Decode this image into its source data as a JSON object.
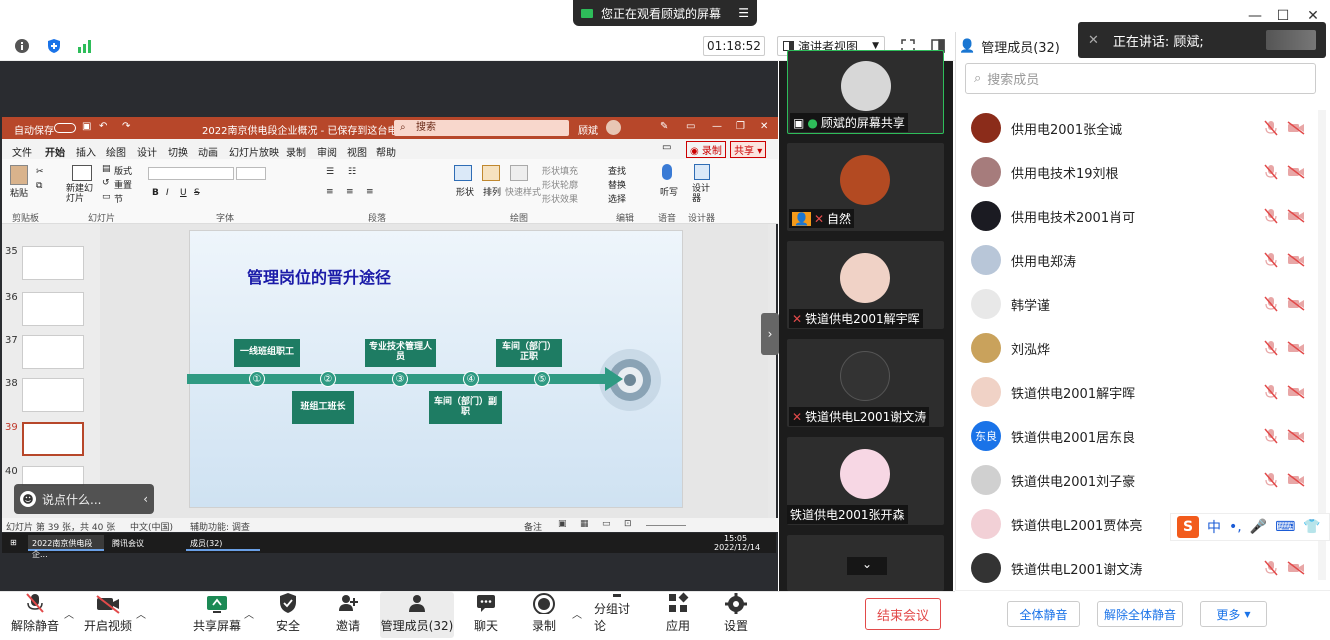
{
  "window": {
    "viewing_banner": "您正在观看顾斌的屏幕"
  },
  "toolbar": {
    "timer": "01:18:52",
    "view_mode": "演讲者视图"
  },
  "panel": {
    "title": "管理成员(32)",
    "speaking_label": "正在讲话: 顾斌;",
    "search_placeholder": "搜索成员",
    "members": [
      {
        "name": "供用电2001张全诚",
        "avatar_color": "#8b2c1a"
      },
      {
        "name": "供用电技术19刘根",
        "avatar_color": "#a67c7c"
      },
      {
        "name": "供用电技术2001肖可",
        "avatar_color": "#1b1b22"
      },
      {
        "name": "供用电郑涛",
        "avatar_color": "#b8c6d8"
      },
      {
        "name": "韩学谨",
        "avatar_color": "#e8e8e8"
      },
      {
        "name": "刘泓烨",
        "avatar_color": "#c9a25c"
      },
      {
        "name": "铁道供电2001解宇晖",
        "avatar_color": "#f0d2c6"
      },
      {
        "name": "铁道供电2001居东良",
        "avatar_color": "#1a73e8",
        "initials": "东良"
      },
      {
        "name": "铁道供电2001刘子豪",
        "avatar_color": "#d0d0d0"
      },
      {
        "name": "铁道供电L2001贾体亮",
        "avatar_color": "#f2d0d6"
      },
      {
        "name": "铁道供电L2001谢文涛",
        "avatar_color": "#333333"
      }
    ],
    "buttons": {
      "mute_all": "全体静音",
      "unmute_all": "解除全体静音",
      "more": "更多"
    }
  },
  "videos": [
    {
      "name": "顾斌的屏幕共享",
      "avatar_color": "#d7d7d7"
    },
    {
      "name": "自然",
      "avatar_color": "#b34a22"
    },
    {
      "name": "铁道供电2001解宇晖",
      "avatar_color": "#f0d2c6"
    },
    {
      "name": "铁道供电L2001谢文涛",
      "avatar_color": "#333333"
    },
    {
      "name": "铁道供电2001张开森",
      "avatar_color": "#f7d7e4"
    }
  ],
  "ppt": {
    "autosave": "自动保存",
    "file_title": "2022南京供电段企业概况 - 已保存到这台电脑",
    "search": "搜索",
    "user": "顾斌",
    "tabs": [
      "文件",
      "开始",
      "插入",
      "绘图",
      "设计",
      "切换",
      "动画",
      "幻灯片放映",
      "录制",
      "审阅",
      "视图",
      "帮助"
    ],
    "record": "录制",
    "share": "共享",
    "groups": [
      "剪贴板",
      "幻灯片",
      "字体",
      "段落",
      "绘图",
      "编辑",
      "语音",
      "设计器"
    ],
    "ribbon_labels": {
      "paste": "粘贴",
      "new_slide": "新建幻灯片",
      "layout": "版式",
      "reset": "重置",
      "section": "节",
      "shape": "形状",
      "arrange": "排列",
      "quick_style": "快速样式",
      "fill": "形状填充",
      "outline": "形状轮廓",
      "effect": "形状效果",
      "find": "查找",
      "replace": "替换",
      "select": "选择",
      "dictate": "听写",
      "designer": "设计器"
    },
    "thumb_numbers": [
      "35",
      "36",
      "37",
      "38",
      "39",
      "40"
    ],
    "slide": {
      "title": "管理岗位的晋升途径",
      "steps": [
        "一线班组职工",
        "班组工班长",
        "专业技术管理人员",
        "车间（部门）副职",
        "车间（部门）正职"
      ],
      "numbers": [
        "①",
        "②",
        "③",
        "④",
        "⑤"
      ]
    },
    "status": {
      "slide_count": "幻灯片 第 39 张，共 40 张",
      "language": "中文(中国)",
      "accessibility": "辅助功能: 调查",
      "notes": "备注"
    },
    "taskbar": {
      "item1": "2022南京供电段企...",
      "item2": "腾讯会议",
      "item3": "成员(32)",
      "time": "15:05",
      "date": "2022/12/14"
    }
  },
  "say_bar": "说点什么...",
  "bottom": {
    "unmute": "解除静音",
    "start_video": "开启视频",
    "share_screen": "共享屏幕",
    "security": "安全",
    "invite": "邀请",
    "members": "管理成员(32)",
    "chat": "聊天",
    "record": "录制",
    "breakout": "分组讨论",
    "apps": "应用",
    "settings": "设置",
    "end_meeting": "结束会议"
  },
  "ime": {
    "lang": "中"
  }
}
